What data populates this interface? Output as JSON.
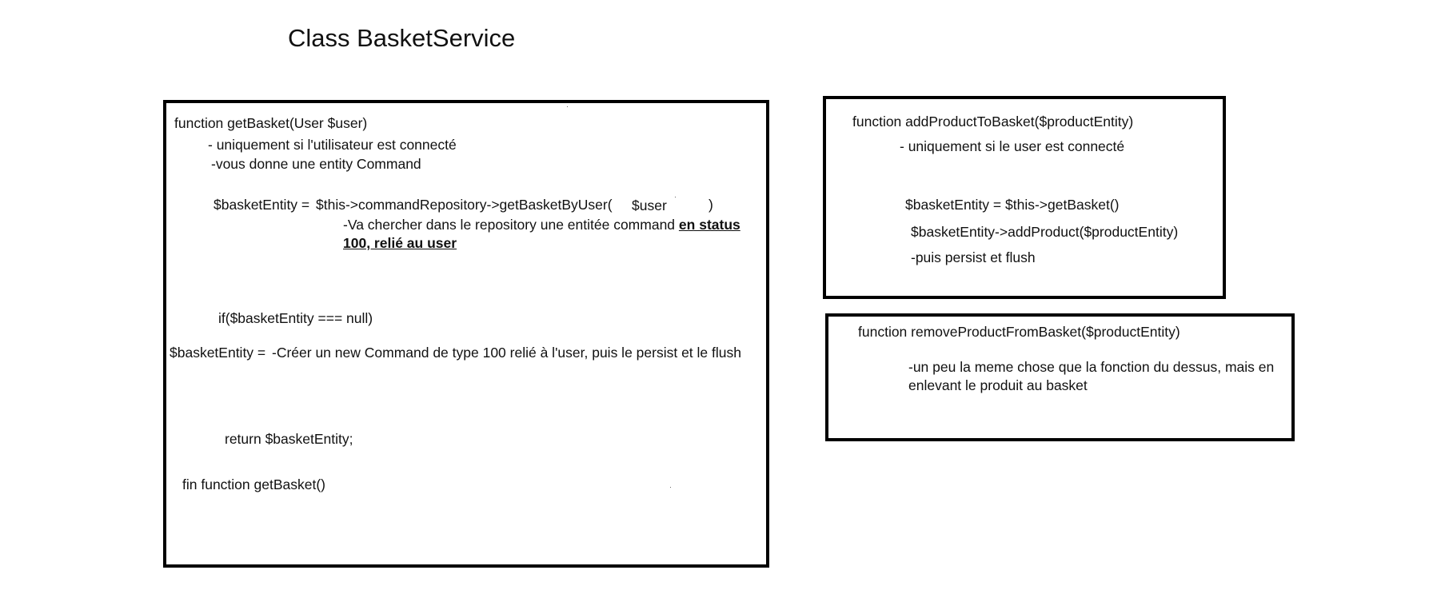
{
  "title": "Class BasketService",
  "get_basket": {
    "signature": "function  getBasket(User $user)",
    "note_connected": "- uniquement si l'utilisateur est connecté",
    "note_returns": "-vous donne une entity Command",
    "assign_lhs": "$basketEntity =",
    "assign_call": "$this->commandRepository->getBasketByUser(",
    "assign_arg": "$user",
    "assign_close": ")",
    "repo_note": "-Va chercher dans le repository une entitée command",
    "repo_note_emph": "en status 100, relié au user",
    "if_line": "if($basketEntity === null)",
    "create_lhs": "$basketEntity =",
    "create_note": "-Créer un new Command de type 100 relié à l'user, puis le persist et le flush",
    "return_line": "return $basketEntity;",
    "end_line": "fin function getBasket()"
  },
  "add_product": {
    "signature": "function addProductToBasket($productEntity)",
    "note_connected": "- uniquement si le user est connecté",
    "line_get": "$basketEntity = $this->getBasket()",
    "line_add": "$basketEntity->addProduct($productEntity)",
    "line_persist": "-puis persist et flush"
  },
  "remove_product": {
    "signature": "function removeProductFromBasket($productEntity)",
    "note": "-un peu la meme chose que la fonction du dessus, mais en enlevant le produit au basket"
  }
}
